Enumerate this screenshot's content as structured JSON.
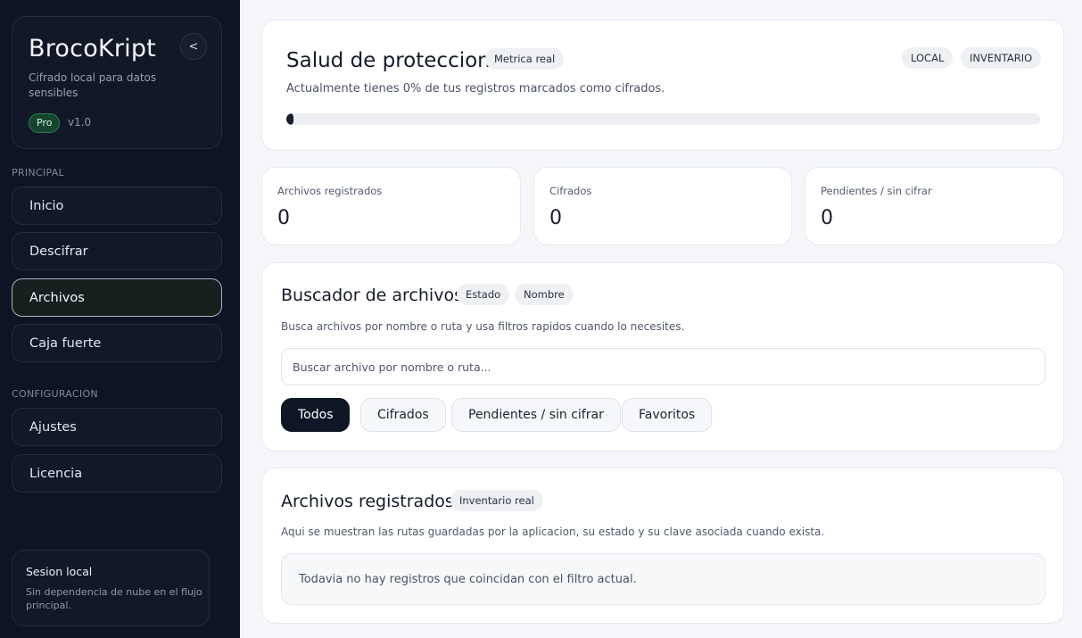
{
  "sidebar": {
    "brand": {
      "title": "BrocoKript",
      "subtitle": "Cifrado local para datos sensibles",
      "badge": "Pro",
      "version": "v1.0",
      "collapse_label": "<"
    },
    "sections": [
      {
        "label": "PRINCIPAL",
        "items": [
          "Inicio",
          "Descifrar",
          "Archivos",
          "Caja fuerte"
        ]
      },
      {
        "label": "CONFIGURACION",
        "items": [
          "Ajustes",
          "Licencia"
        ]
      }
    ],
    "active_item": "Archivos",
    "session": {
      "title": "Sesion local",
      "text": "Sin dependencia de nube en el flujo principal."
    }
  },
  "health": {
    "title": "Salud de proteccion",
    "pill": "Metrica real",
    "tags": [
      "LOCAL",
      "INVENTARIO"
    ],
    "description": "Actualmente tienes 0% de tus registros marcados como cifrados.",
    "progress_percent": 0
  },
  "stats": [
    {
      "label": "Archivos registrados",
      "value": "0"
    },
    {
      "label": "Cifrados",
      "value": "0"
    },
    {
      "label": "Pendientes / sin cifrar",
      "value": "0"
    }
  ],
  "search": {
    "title": "Buscador de archivos",
    "pills": [
      "Estado",
      "Nombre"
    ],
    "description": "Busca archivos por nombre o ruta y usa filtros rapidos cuando lo necesites.",
    "placeholder": "Buscar archivo por nombre o ruta...",
    "filters": [
      "Todos",
      "Cifrados",
      "Pendientes / sin cifrar",
      "Favoritos"
    ],
    "active_filter": "Todos"
  },
  "list": {
    "title": "Archivos registrados",
    "pill": "Inventario real",
    "description": "Aqui se muestran las rutas guardadas por la aplicacion, su estado y su clave asociada cuando exista.",
    "empty_text": "Todavia no hay registros que coincidan con el filtro actual."
  },
  "colors": {
    "sidebar_bg": "#0e1424",
    "accent_dark": "#0f1626",
    "pro_badge": "#15452f"
  }
}
